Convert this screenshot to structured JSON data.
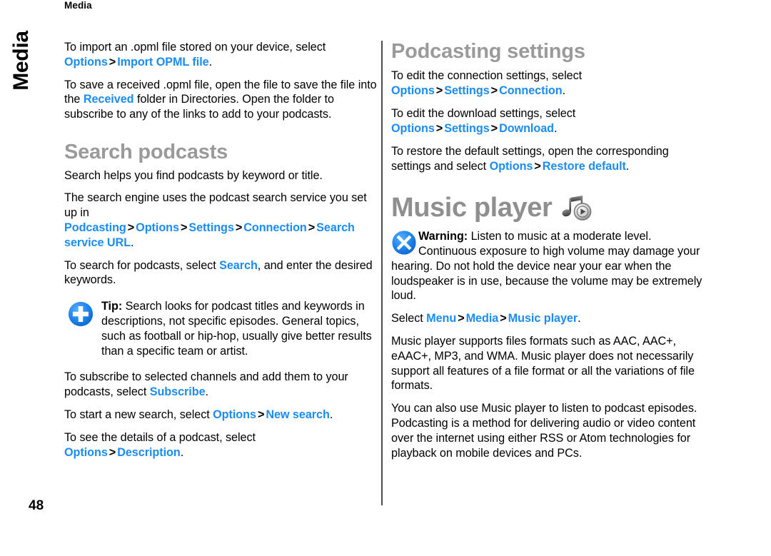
{
  "document": {
    "running_header": "Media",
    "side_tab": "Media",
    "page_number": "48",
    "accent_color": "#1b8cf5",
    "heading_color": "#9a9a9a",
    "divider_color": "#4d4d4d"
  },
  "left_column": {
    "p_import": {
      "t1": "To import an .opml file stored on your device, select ",
      "ui1": "Options",
      "sep1": ">",
      "ui2": "Import OPML file",
      "t2": "."
    },
    "p_save": {
      "t1": "To save a received .opml file, open the file to save the file into the ",
      "ui1": "Received",
      "t2": " folder in Directories. Open the folder to subscribe to any of the links to add to your podcasts."
    },
    "heading_search_podcasts": "Search podcasts",
    "p_search_helps": "Search helps you find podcasts by keyword or title.",
    "p_search_engine": {
      "t1": "The search engine uses the podcast search service you set up in ",
      "ui1": "Podcasting",
      "sep1": ">",
      "ui2": "Options",
      "sep2": ">",
      "ui3": "Settings",
      "sep3": ">",
      "ui4": "Connection",
      "sep4": ">",
      "ui5": "Search service URL",
      "t2": "."
    },
    "p_to_search": {
      "t1": "To search for podcasts, select ",
      "ui1": "Search",
      "t2": ", and enter the desired keywords."
    },
    "tip": {
      "icon": "tip-plus-icon",
      "label": "Tip:",
      "text": " Search looks for podcast titles and keywords in descriptions, not specific episodes. General topics, such as football or hip-hop, usually give better results than a specific team or artist."
    },
    "p_subscribe": {
      "t1": "To subscribe to selected channels and add them to your podcasts, select ",
      "ui1": "Subscribe",
      "t2": "."
    },
    "p_new_search": {
      "t1": "To start a new search, select ",
      "ui1": "Options",
      "sep1": ">",
      "ui2": "New search",
      "t2": "."
    },
    "p_details": {
      "t1": "To see the details of a podcast, select ",
      "ui1": "Options",
      "sep1": ">",
      "ui2": "Description",
      "t2": "."
    }
  },
  "right_column": {
    "heading_podcasting_settings": "Podcasting settings",
    "p_connection": {
      "t1": "To edit the connection settings, select ",
      "ui1": "Options",
      "sep1": ">",
      "ui2": "Settings",
      "sep2": ">",
      "ui3": "Connection",
      "t2": "."
    },
    "p_download": {
      "t1": "To edit the download settings, select ",
      "ui1": "Options",
      "sep1": ">",
      "ui2": "Settings",
      "sep2": ">",
      "ui3": "Download",
      "t2": "."
    },
    "p_restore": {
      "t1": "To restore the default settings, open the corresponding settings and select ",
      "ui1": "Options",
      "sep1": ">",
      "ui2": "Restore default",
      "t2": "."
    },
    "heading_music_player": "Music player",
    "music_player_icon": "music-note-play-icon",
    "warning": {
      "icon": "warning-x-icon",
      "label": "Warning:",
      "text": " Listen to music at a moderate level. Continuous exposure to high volume may damage your hearing. Do not hold the device near your ear when the loudspeaker is in use, because the volume may be extremely loud."
    },
    "p_select_menu": {
      "t1": "Select ",
      "ui1": "Menu",
      "sep1": ">",
      "ui2": "Media",
      "sep2": ">",
      "ui3": "Music player",
      "t2": "."
    },
    "p_formats": "Music player supports files formats such as AAC, AAC+, eAAC+, MP3, and WMA. Music player does not necessarily support all features of a file format or all the variations of file formats.",
    "p_podcast_episodes": "You can also use Music player to listen to podcast episodes. Podcasting is a method for delivering audio or video content over the internet using either RSS or Atom technologies for playback on mobile devices and PCs."
  }
}
